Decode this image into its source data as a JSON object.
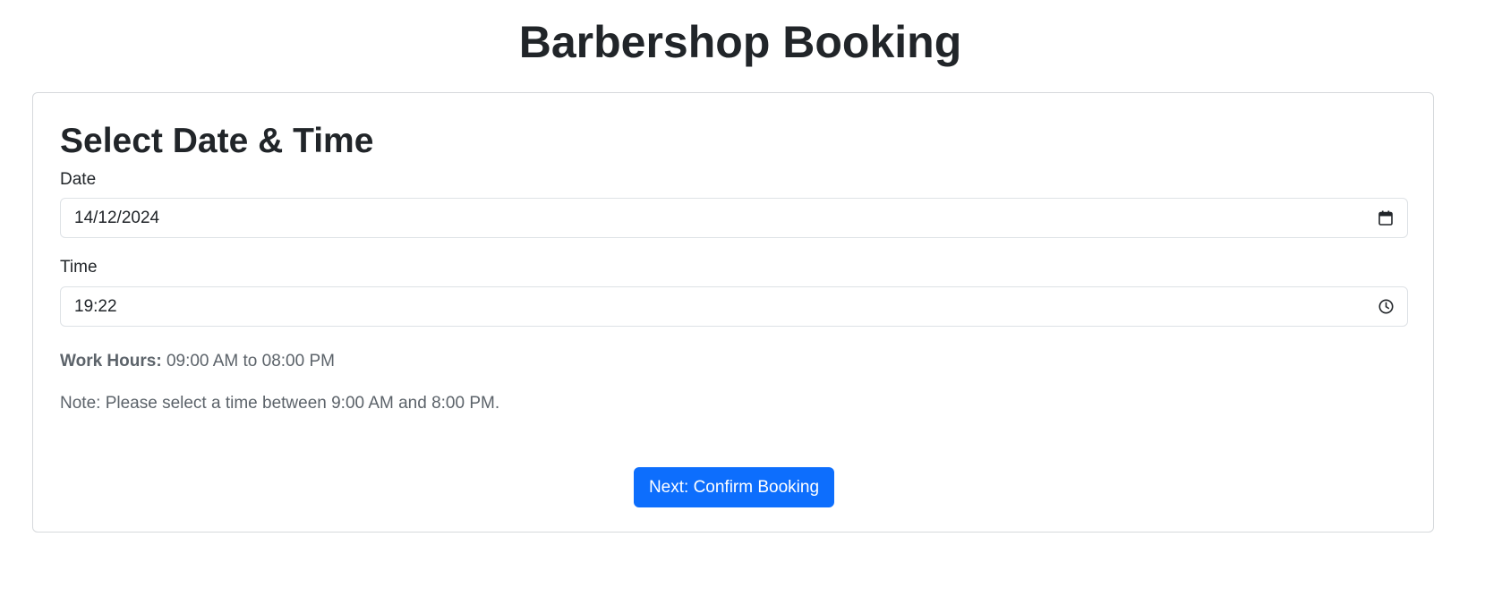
{
  "header": {
    "title": "Barbershop Booking"
  },
  "form": {
    "section_title": "Select Date & Time",
    "date": {
      "label": "Date",
      "value": "14/12/2024",
      "icon": "calendar-icon"
    },
    "time": {
      "label": "Time",
      "value": "19:22",
      "icon": "clock-icon"
    },
    "work_hours": {
      "label": "Work Hours:",
      "value": "09:00 AM to 08:00 PM"
    },
    "note": "Note: Please select a time between 9:00 AM and 8:00 PM.",
    "next_button_label": "Next: Confirm Booking"
  },
  "colors": {
    "primary": "#0d6efd",
    "text": "#212529",
    "muted_text": "#5c636a",
    "border": "#dee2e6"
  }
}
